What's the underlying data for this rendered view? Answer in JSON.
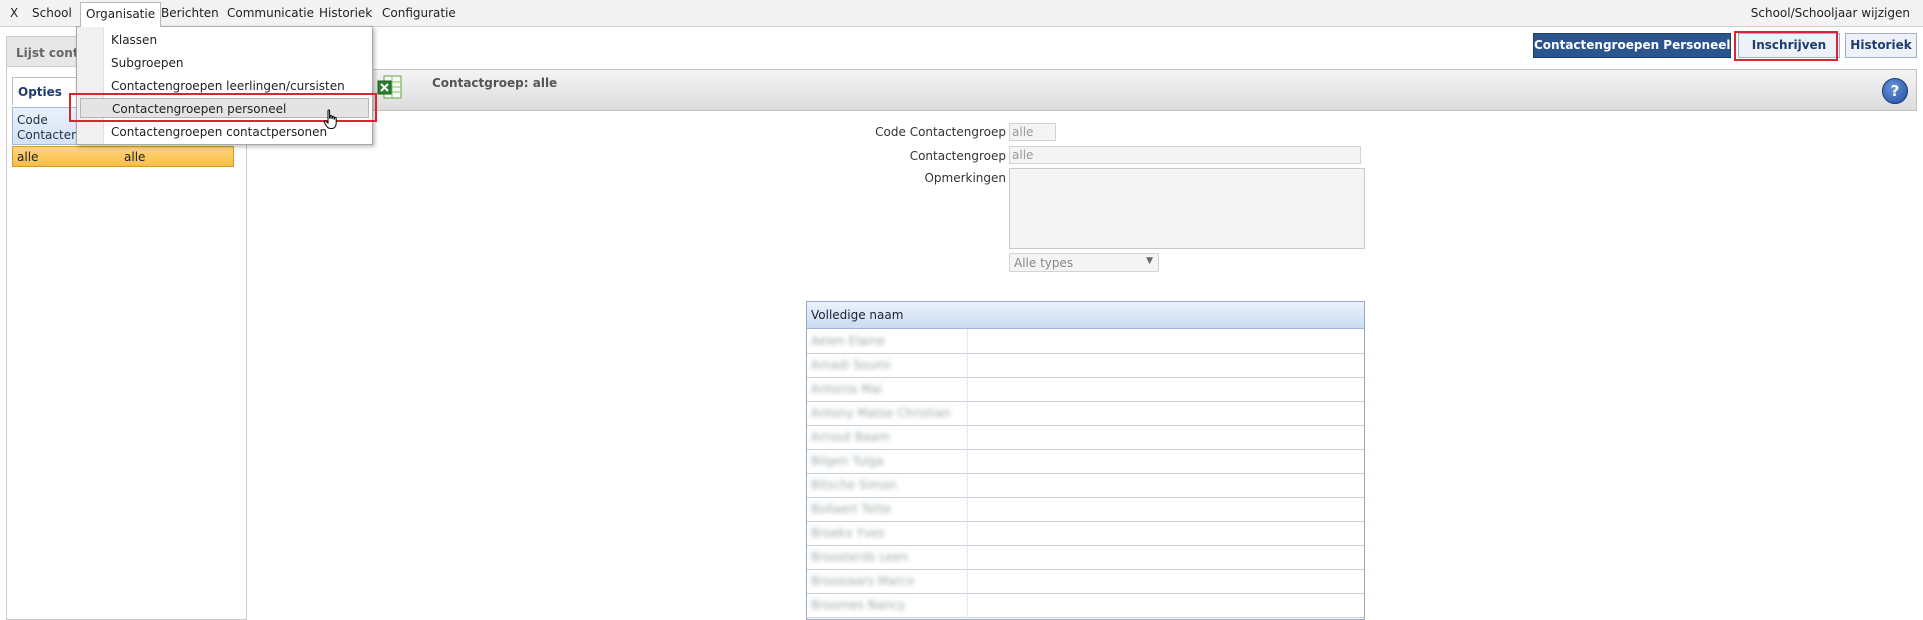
{
  "menu": {
    "close": "X",
    "items": [
      "School",
      "Organisatie",
      "Berichten",
      "Communicatie",
      "Historiek",
      "Configuratie"
    ],
    "active": "Organisatie",
    "right": "School/Schooljaar wijzigen"
  },
  "dropdown": {
    "items": [
      "Klassen",
      "Subgroepen",
      "Contactengroepen leerlingen/cursisten",
      "Contactengroepen personeel",
      "Contactengroepen contactpersonen"
    ],
    "highlighted": "Contactengroepen personeel"
  },
  "left_panel": {
    "title": "Lijst contac",
    "tab": "Opties",
    "grid_header": "Code Contacteng",
    "rows": [
      {
        "code": "alle",
        "name": "alle"
      }
    ]
  },
  "top_buttons": {
    "personeel": "Contactengroepen Personeel",
    "inschrijven": "Inschrijven",
    "historiek": "Historiek"
  },
  "toolbar": {
    "title": "Contactgroep: alle",
    "help": "?"
  },
  "form": {
    "code_label": "Code Contactengroep",
    "code_value": "alle",
    "group_label": "Contactengroep",
    "group_value": "alle",
    "remarks_label": "Opmerkingen",
    "remarks_value": "",
    "type_value": "Alle types"
  },
  "members": {
    "header": "Volledige naam",
    "rows": [
      "Aelen Elaine",
      "Amadi Soumi",
      "Antonia Mai",
      "Antony Matse Christian",
      "Arnout Baam",
      "Bilgen Tulga",
      "Bitsche Simon",
      "Bollaert Totte",
      "Broekx Yves",
      "Broosterds Leen",
      "Broosiaars Marco",
      "Broomes Nancy"
    ]
  },
  "colors": {
    "accent": "#2c548f",
    "selection": "#f7bf47",
    "annotation": "#d9262e"
  }
}
